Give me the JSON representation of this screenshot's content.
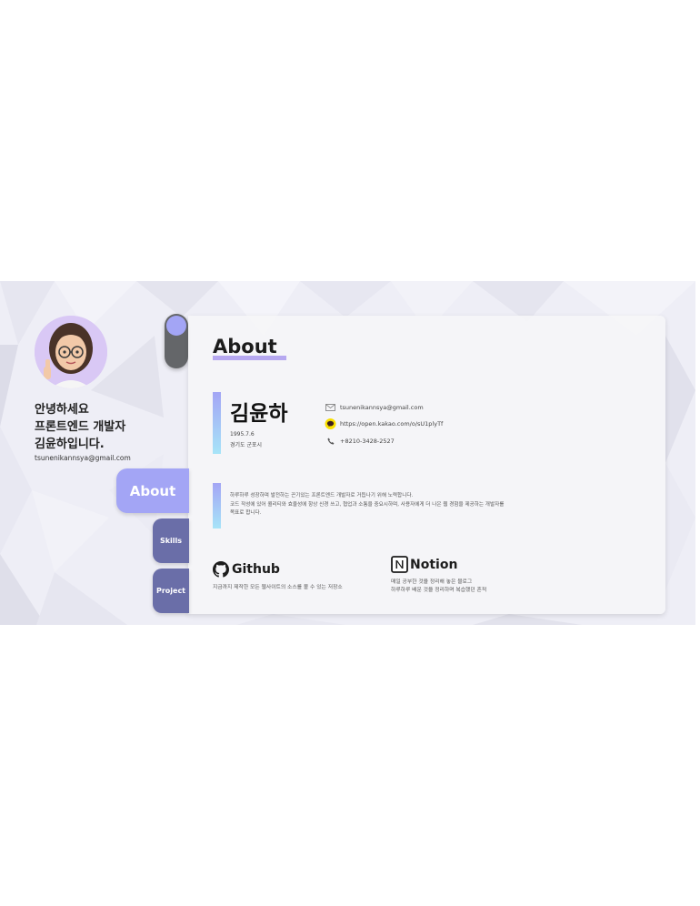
{
  "sidebar": {
    "greeting_line1": "안녕하세요",
    "greeting_line2": "프론트엔드 개발자",
    "greeting_line3": "김윤하입니다.",
    "email": "tsunenikannsya@gmail.com"
  },
  "nav": {
    "about": "About",
    "skills": "Skills",
    "project": "Project",
    "active": "About"
  },
  "theme_toggle": {
    "knob_color": "#a3a5f5"
  },
  "about": {
    "title": "About",
    "name": "김윤하",
    "birth": "1995.7.6",
    "location": "경기도 군포시",
    "contacts": {
      "email": "tsunenikannsya@gmail.com",
      "kakao": "https://open.kakao.com/o/sU1plyTf",
      "phone": "+8210-3428-2527"
    },
    "description": [
      "하루하루 성장하며 발전하는 끈기있는 프론트엔드 개발자로 거듭나기 위해 노력합니다.",
      "코드 작성에 있어 퀄리티와 효율성에 항상 신경 쓰고, 협업과 소통을 중요시하며, 사용자에게 더 나은 웹 경험을 제공하는 개발자를",
      "목표로 합니다."
    ],
    "github": {
      "label": "Github",
      "desc": "지금까지 제작한 모든 웹사이트의 소스를 볼 수 있는 저장소"
    },
    "notion": {
      "label": "Notion",
      "desc_line1": "매일 공부한 것을 정리해 놓은 블로그",
      "desc_line2": "하루하루 배운 것을 정리하며 복습했던 흔적"
    }
  },
  "colors": {
    "accent": "#a3a5f5",
    "nav_inactive": "#6a6ea8",
    "background": "#eeeef6",
    "gradient_end": "#a7e4f8"
  },
  "icons": {
    "email": "mail-icon",
    "kakao": "kakao-chat-icon",
    "phone": "phone-icon",
    "github": "github-icon",
    "notion": "notion-icon"
  }
}
